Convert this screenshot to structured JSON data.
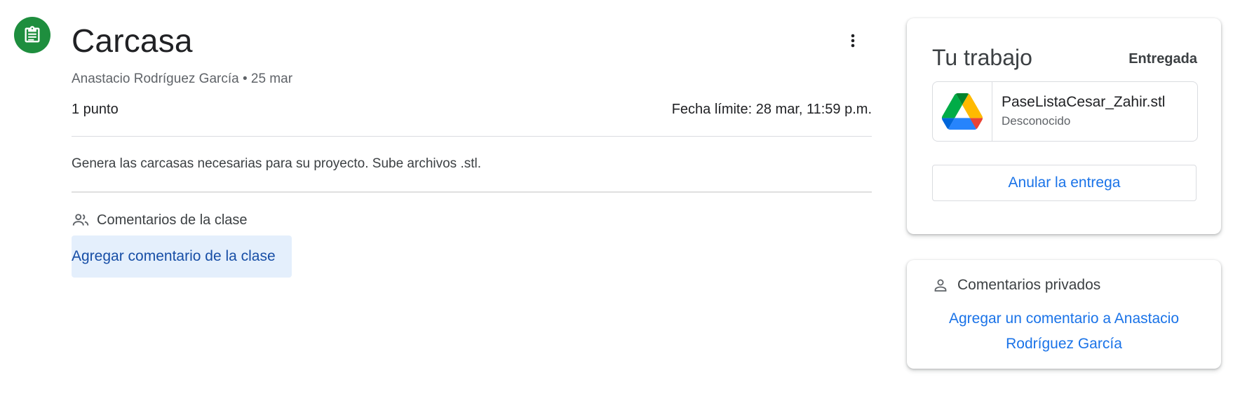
{
  "assignment": {
    "icon": "assignment-clipboard-icon",
    "title": "Carcasa",
    "meta": "Anastacio Rodríguez García • 25 mar",
    "points": "1 punto",
    "due": "Fecha límite: 28 mar, 11:59 p.m.",
    "description": "Genera las carcasas necesarias para su proyecto. Sube archivos .stl.",
    "more_icon": "more-vert-icon"
  },
  "class_comments": {
    "icon": "people-icon",
    "label": "Comentarios de la clase",
    "add_label": "Agregar comentario de la clase"
  },
  "your_work": {
    "title": "Tu trabajo",
    "status": "Entregada",
    "file": {
      "icon": "google-drive-icon",
      "name": "PaseListaCesar_Zahir.stl",
      "type": "Desconocido"
    },
    "unsubmit_label": "Anular la entrega"
  },
  "private_comments": {
    "icon": "person-icon",
    "label": "Comentarios privados",
    "add_label": "Agregar un comentario a Anastacio Rodríguez García"
  },
  "colors": {
    "assignment_green": "#1e8e3e",
    "link_blue": "#1a73e8",
    "class_comment_bg": "#e4effc"
  }
}
